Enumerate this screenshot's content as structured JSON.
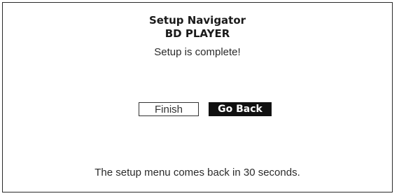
{
  "dialog": {
    "title": "Setup Navigator",
    "subtitle": "BD PLAYER",
    "status": "Setup is complete!",
    "footer_message": "The setup menu comes back in 30 seconds."
  },
  "buttons": {
    "finish_label": "Finish",
    "go_back_label": "Go Back",
    "selected": "Go Back"
  },
  "colors": {
    "background": "#ffffff",
    "border": "#2a2a2a",
    "text": "#2a2a2a",
    "selected_button_bg": "#111111",
    "selected_button_text": "#ffffff"
  }
}
